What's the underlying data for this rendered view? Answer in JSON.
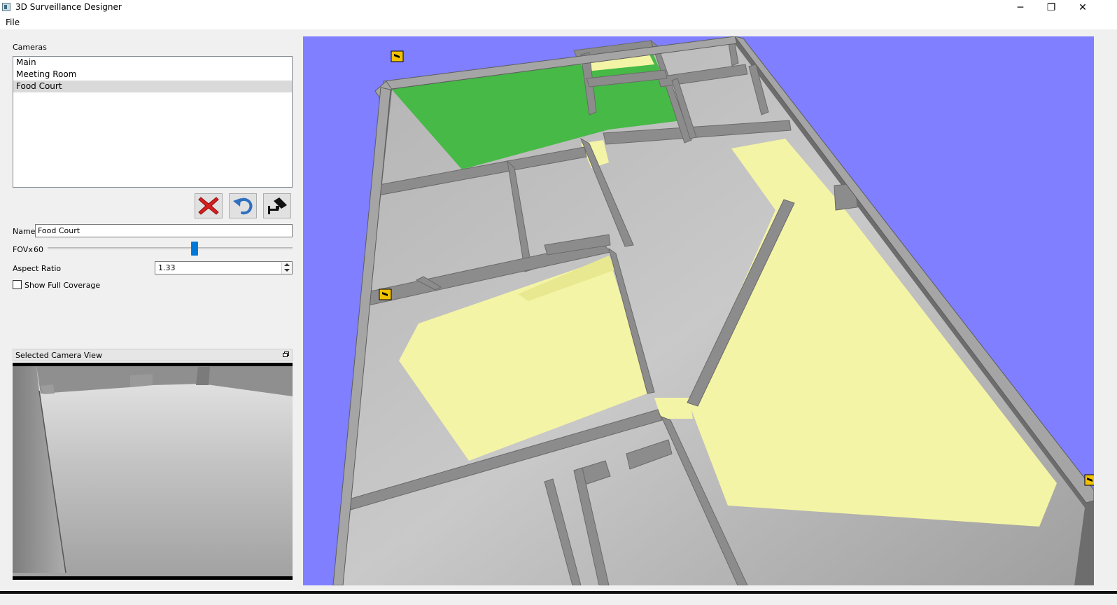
{
  "window": {
    "title": "3D Surveillance Designer",
    "minimize_glyph": "─",
    "restore_glyph": "❐",
    "close_glyph": "✕"
  },
  "menu": {
    "file": "File"
  },
  "cameras_panel": {
    "label": "Cameras",
    "items": [
      "Main",
      "Meeting Room",
      "Food Court"
    ],
    "selected": "Food Court"
  },
  "toolbar": {
    "delete_icon": "red-x-icon",
    "undo_icon": "undo-arrow-icon",
    "add_camera_icon": "camera-icon"
  },
  "properties": {
    "name_label": "Name",
    "name_value": "Food Court",
    "fov_label": "FOVx",
    "fov_value": "60",
    "aspect_label": "Aspect Ratio",
    "aspect_value": "1.33",
    "full_coverage_label": "Show Full Coverage",
    "full_coverage_checked": false
  },
  "camera_view": {
    "title": "Selected Camera View"
  },
  "colors": {
    "viewport_bg": "#7f7fff",
    "coverage_selected": "#f4f4a6",
    "coverage_other": "#3cb83c",
    "slider_accent": "#0078d7"
  }
}
